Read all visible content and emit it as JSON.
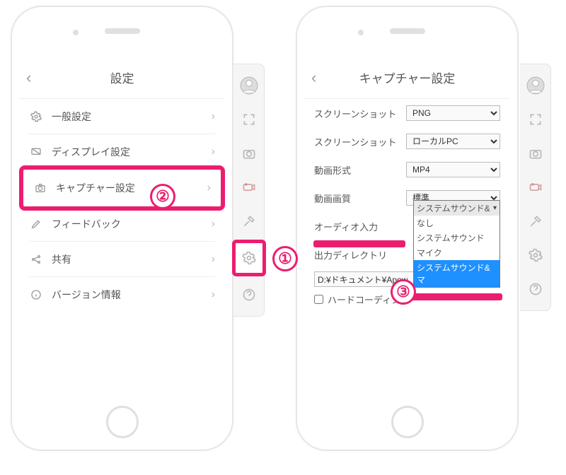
{
  "left": {
    "header_title": "設定",
    "rows": [
      {
        "label": "一般設定"
      },
      {
        "label": "ディスプレイ設定"
      },
      {
        "label": "キャプチャー設定"
      },
      {
        "label": "フィードバック"
      },
      {
        "label": "共有"
      },
      {
        "label": "バージョン情報"
      }
    ]
  },
  "right": {
    "header_title": "キャプチャー設定",
    "fields": {
      "screenshot_format_label": "スクリーンショット",
      "screenshot_format_value": "PNG",
      "screenshot_dest_label": "スクリーンショット",
      "screenshot_dest_value": "ローカルPC",
      "video_format_label": "動画形式",
      "video_format_value": "MP4",
      "video_quality_label": "動画画質",
      "video_quality_value": "標準",
      "audio_input_label": "オーディオ入力",
      "output_dir_label": "出力ディレクトリ",
      "output_dir_value": "D:¥ドキュメント¥Apow",
      "hardcoding_label": "ハードコーディング"
    },
    "audio_dropdown": {
      "current": "システムサウンド&",
      "options": [
        "なし",
        "システムサウンド",
        "マイク",
        "システムサウンド&マ"
      ],
      "selected_index": 3
    }
  },
  "badges": {
    "b1": "①",
    "b2": "②",
    "b3": "③"
  }
}
